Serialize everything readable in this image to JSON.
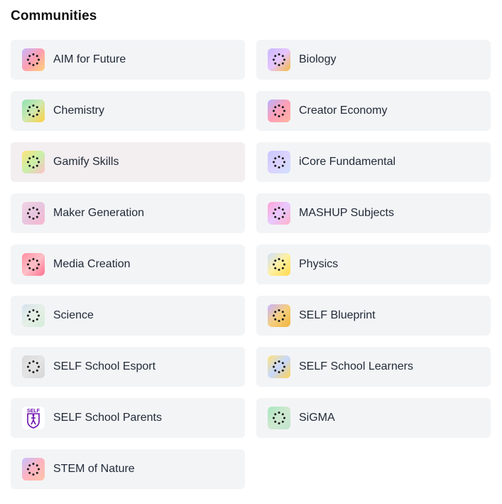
{
  "header": {
    "title": "Communities"
  },
  "communities": [
    {
      "name": "AIM for Future",
      "icon": "loader-dots-icon",
      "gradient": [
        "#c7b6ff",
        "#ff9fb0",
        "#ffd27a"
      ]
    },
    {
      "name": "Biology",
      "icon": "loader-dots-icon",
      "gradient": [
        "#c9b8ff",
        "#e7c6ff",
        "#f5b83f"
      ]
    },
    {
      "name": "Chemistry",
      "icon": "loader-dots-icon",
      "gradient": [
        "#8fe3b2",
        "#cfe8b0",
        "#ffcf3e"
      ]
    },
    {
      "name": "Creator Economy",
      "icon": "loader-dots-icon",
      "gradient": [
        "#b7b3ff",
        "#ff9fb7",
        "#ffb3a0"
      ]
    },
    {
      "name": "Gamify Skills",
      "icon": "loader-dots-icon",
      "gradient": [
        "#ffe27a",
        "#c8f0a8",
        "#ffc0c8"
      ]
    },
    {
      "name": "iCore Fundamental",
      "icon": "loader-dots-icon",
      "gradient": [
        "#c9c6ff",
        "#dcd3ff",
        "#cfe0ff"
      ]
    },
    {
      "name": "Maker Generation",
      "icon": "loader-dots-icon",
      "gradient": [
        "#f2d2e3",
        "#e7c6df",
        "#f7b6cf"
      ]
    },
    {
      "name": "MASHUP Subjects",
      "icon": "loader-dots-icon",
      "gradient": [
        "#ffa3d5",
        "#e8c9ff",
        "#ffb0c8"
      ]
    },
    {
      "name": "Media Creation",
      "icon": "loader-dots-icon",
      "gradient": [
        "#ff8ea0",
        "#ffc0c8",
        "#ff6f8d"
      ]
    },
    {
      "name": "Physics",
      "icon": "loader-dots-icon",
      "gradient": [
        "#cfe0ff",
        "#fff0a0",
        "#ffd84a"
      ]
    },
    {
      "name": "Science",
      "icon": "loader-dots-icon",
      "gradient": [
        "#d5e2ef",
        "#e6efe6",
        "#d4ecd9"
      ]
    },
    {
      "name": "SELF Blueprint",
      "icon": "loader-dots-icon",
      "gradient": [
        "#c9b3ff",
        "#f5cf80",
        "#f0b33a"
      ]
    },
    {
      "name": "SELF School Esport",
      "icon": "loader-dots-icon",
      "gradient": [
        "#dadada",
        "#e4e4e4",
        "#d6d6d6"
      ]
    },
    {
      "name": "SELF School Learners",
      "icon": "loader-dots-icon",
      "gradient": [
        "#ffe27a",
        "#c7d9ff",
        "#ffd24d"
      ]
    },
    {
      "name": "SELF School Parents",
      "icon": "self-logo-icon",
      "logo_text": "SELF",
      "logo_color": "#6a0dad"
    },
    {
      "name": "SiGMA",
      "icon": "loader-dots-icon",
      "gradient": [
        "#a8e8c0",
        "#cfe8d0",
        "#bfe6cf"
      ]
    },
    {
      "name": "STEM of Nature",
      "icon": "loader-dots-icon",
      "gradient": [
        "#c6c0ff",
        "#ffb3c0",
        "#ffc5a8"
      ]
    }
  ],
  "hovered_index": 4
}
